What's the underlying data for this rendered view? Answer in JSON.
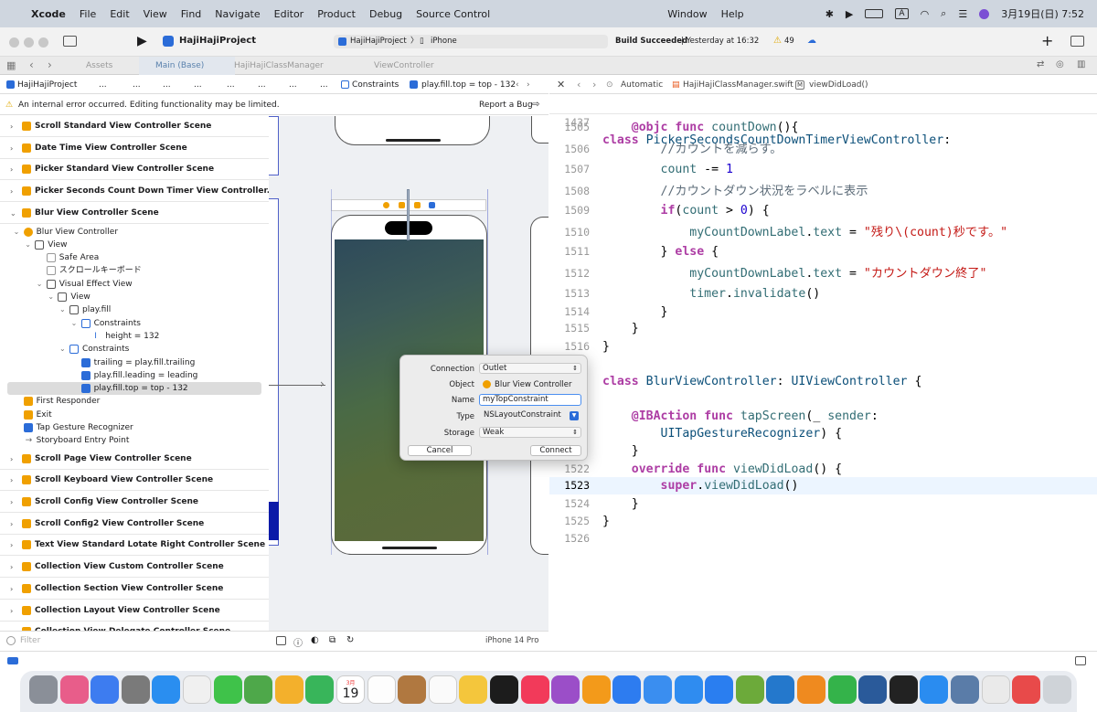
{
  "menubar": {
    "app_name": "Xcode",
    "items": [
      "File",
      "Edit",
      "View",
      "Find",
      "Navigate",
      "Editor",
      "Product",
      "Debug",
      "Source Control",
      "Window",
      "Help"
    ],
    "datetime": "3月19日(日)  7:52"
  },
  "toolbar": {
    "project": "HajiHajiProject",
    "scheme": "HajiHajiProject",
    "device": "iPhone",
    "status_bold": "Build Succeeded",
    "status_rest": " | Yesterday at 16:32",
    "warnings": "49"
  },
  "tabs": [
    "Assets",
    "Main (Base)",
    "HajiHajiClassManager",
    "ViewController"
  ],
  "jumpbar_left": [
    "HajiHajiProject",
    "...",
    "...",
    "...",
    "...",
    "...",
    "...",
    "...",
    "...",
    "Constraints",
    "play.fill.top = top - 132"
  ],
  "jumpbar_right": [
    "Automatic",
    "HajiHajiClassManager.swift",
    "viewDidLoad()"
  ],
  "error_bar": {
    "message": "An internal error occurred. Editing functionality may be limited.",
    "button": "Report a Bug"
  },
  "outline": {
    "scenes_top": [
      "Scroll Standard View Controller Scene",
      "Date Time View Controller Scene",
      "Picker Standard View Controller Scene",
      "Picker Seconds Count Down Timer View Controller..."
    ],
    "blur_scene": "Blur View Controller Scene",
    "tree": [
      {
        "label": "Blur View Controller",
        "indent": 1,
        "icon": "orangec",
        "chev": "open"
      },
      {
        "label": "View",
        "indent": 2,
        "icon": "box",
        "chev": "open"
      },
      {
        "label": "Safe Area",
        "indent": 3,
        "icon": "gray",
        "chev": ""
      },
      {
        "label": "スクロールキーボード",
        "indent": 3,
        "icon": "gray",
        "chev": ""
      },
      {
        "label": "Visual Effect View",
        "indent": 3,
        "icon": "box",
        "chev": "open"
      },
      {
        "label": "View",
        "indent": 4,
        "icon": "box",
        "chev": "open"
      },
      {
        "label": "play.fill",
        "indent": 5,
        "icon": "box",
        "chev": "open"
      },
      {
        "label": "Constraints",
        "indent": 6,
        "icon": "blueb",
        "chev": "open"
      },
      {
        "label": "height = 132",
        "indent": 7,
        "icon": "none",
        "chev": ""
      },
      {
        "label": "Constraints",
        "indent": 5,
        "icon": "blueb",
        "chev": "open"
      },
      {
        "label": "trailing = play.fill.trailing",
        "indent": 6,
        "icon": "blue",
        "chev": ""
      },
      {
        "label": "play.fill.leading = leading",
        "indent": 6,
        "icon": "blue",
        "chev": ""
      },
      {
        "label": "play.fill.top = top - 132",
        "indent": 6,
        "icon": "blue",
        "chev": "",
        "selected": true
      },
      {
        "label": "First Responder",
        "indent": 1,
        "icon": "orange",
        "chev": ""
      },
      {
        "label": "Exit",
        "indent": 1,
        "icon": "orange",
        "chev": ""
      },
      {
        "label": "Tap Gesture Recognizer",
        "indent": 1,
        "icon": "blue",
        "chev": ""
      },
      {
        "label": "Storyboard Entry Point",
        "indent": 1,
        "icon": "none",
        "chev": ""
      }
    ],
    "scenes_bottom": [
      "Scroll Page View Controller Scene",
      "Scroll Keyboard View Controller Scene",
      "Scroll Config View Controller Scene",
      "Scroll Config2 View Controller Scene",
      "Text View Standard Lotate Right Controller Scene",
      "Collection View Custom Controller Scene",
      "Collection Section View Controller Scene",
      "Collection Layout View Controller Scene",
      "Collection View Delegate Controller Scene"
    ]
  },
  "filter_placeholder": "Filter",
  "canvas": {
    "device_label": "iPhone 14 Pro"
  },
  "popup": {
    "labels": {
      "connection": "Connection",
      "object": "Object",
      "name": "Name",
      "type": "Type",
      "storage": "Storage"
    },
    "connection": "Outlet",
    "object": "Blur View Controller",
    "name": "myTopConstraint",
    "type": "NSLayoutConstraint",
    "storage": "Weak",
    "cancel": "Cancel",
    "connect": "Connect"
  },
  "code": {
    "sticky_line": "1437",
    "sticky_text": "class PickerSecondsCountDownTimerViewController:",
    "lines": [
      {
        "n": "1505",
        "t": "    @objc func countDown(){"
      },
      {
        "n": "1506",
        "t": "        //カウントを減らす。"
      },
      {
        "n": "1507",
        "t": "        count -= 1"
      },
      {
        "n": "1508",
        "t": "        //カウントダウン状況をラベルに表示"
      },
      {
        "n": "1509",
        "t": "        if(count > 0) {"
      },
      {
        "n": "1510",
        "t": "            myCountDownLabel.text = \"残り\\(count)秒です。\""
      },
      {
        "n": "1511",
        "t": "        } else {"
      },
      {
        "n": "1512",
        "t": "            myCountDownLabel.text = \"カウントダウン終了\""
      },
      {
        "n": "1513",
        "t": "            timer.invalidate()"
      },
      {
        "n": "1514",
        "t": "        }"
      },
      {
        "n": "1515",
        "t": "    }"
      },
      {
        "n": "1516",
        "t": "}"
      },
      {
        "n": "",
        "t": ""
      },
      {
        "n": "",
        "t": "class BlurViewController: UIViewController {"
      },
      {
        "n": "",
        "t": ""
      },
      {
        "n": "",
        "t": "    @IBAction func tapScreen(_ sender:"
      },
      {
        "n": "",
        "t": "        UITapGestureRecognizer) {"
      },
      {
        "n": "",
        "t": "    }"
      },
      {
        "n": "1522",
        "t": "    override func viewDidLoad() {"
      },
      {
        "n": "1523",
        "t": "        super.viewDidLoad()"
      },
      {
        "n": "1524",
        "t": "    }"
      },
      {
        "n": "1525",
        "t": "}"
      },
      {
        "n": "1526",
        "t": ""
      }
    ]
  },
  "dock_calendar": {
    "month": "3月",
    "day": "19"
  },
  "colors": {
    "accent": "#2b6cd8",
    "selection": "#dcdcdc",
    "current_line": "#ecf5ff"
  }
}
